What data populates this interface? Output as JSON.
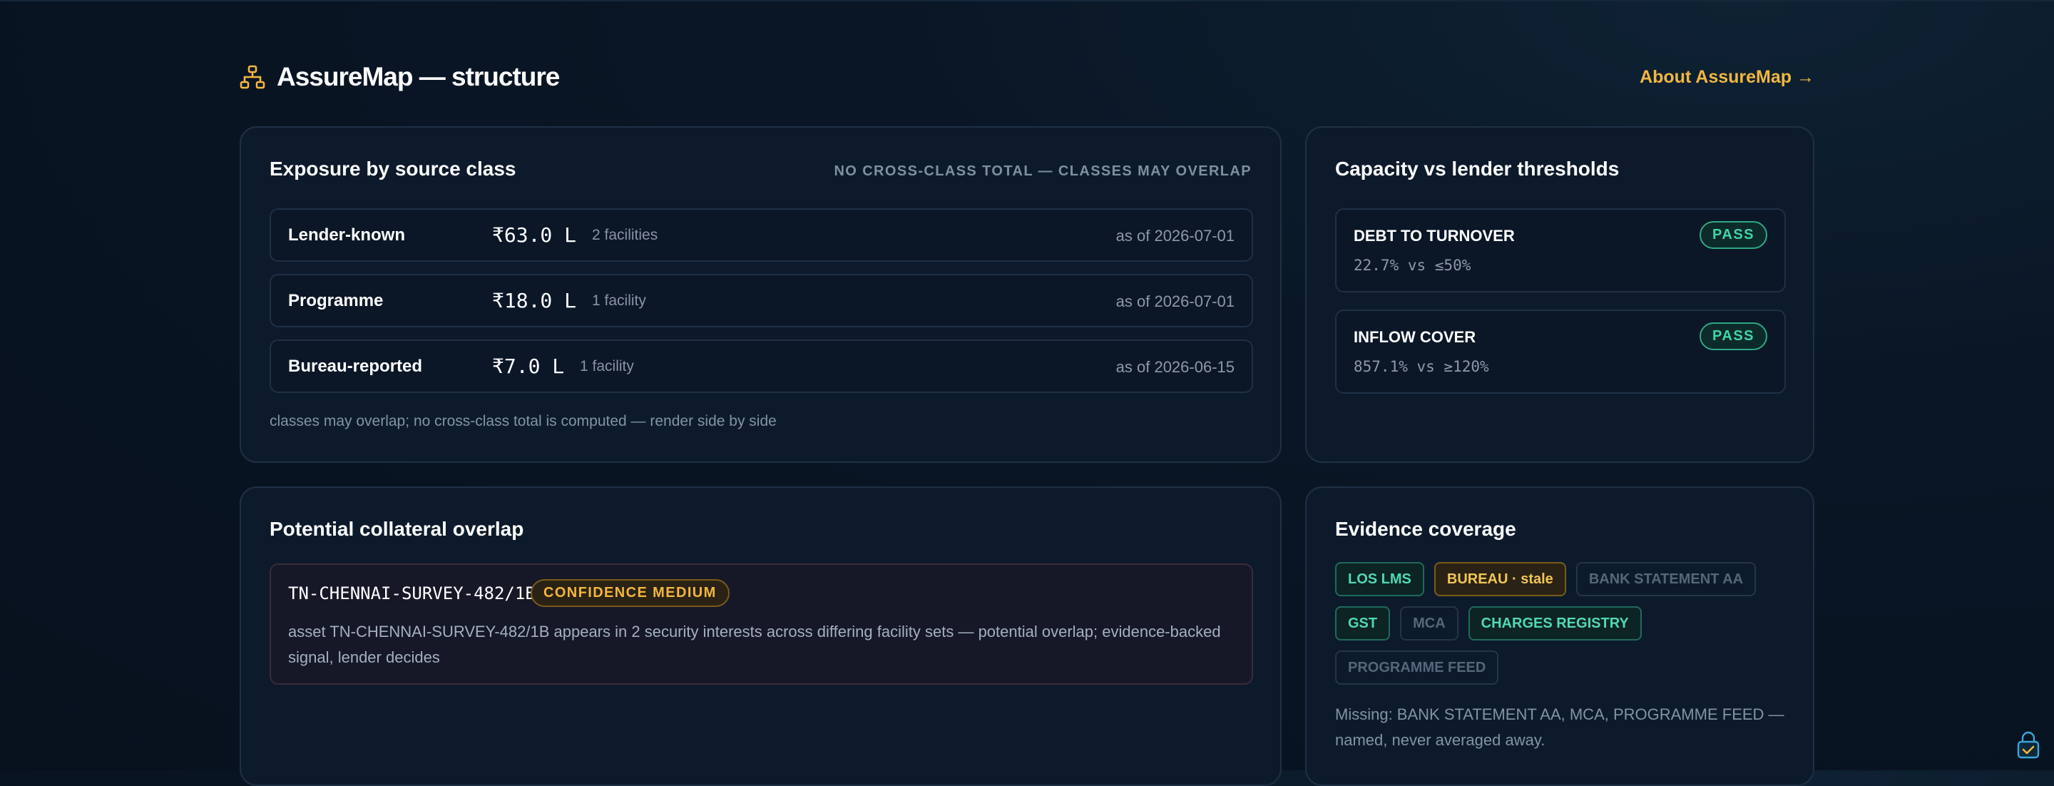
{
  "header": {
    "title": "AssureMap — structure",
    "about_link": "About AssureMap →"
  },
  "exposure": {
    "title": "Exposure by source class",
    "note": "NO CROSS-CLASS TOTAL — CLASSES MAY OVERLAP",
    "rows": [
      {
        "label": "Lender-known",
        "amount": "₹63.0 L",
        "count": "2 facilities",
        "as_of": "as of 2026-07-01"
      },
      {
        "label": "Programme",
        "amount": "₹18.0 L",
        "count": "1 facility",
        "as_of": "as of 2026-07-01"
      },
      {
        "label": "Bureau-reported",
        "amount": "₹7.0 L",
        "count": "1 facility",
        "as_of": "as of 2026-06-15"
      }
    ],
    "footnote": "classes may overlap; no cross-class total is computed — render side by side"
  },
  "capacity": {
    "title": "Capacity vs lender thresholds",
    "rows": [
      {
        "name": "DEBT TO TURNOVER",
        "value": "22.7% vs ≤50%",
        "status": "PASS"
      },
      {
        "name": "INFLOW COVER",
        "value": "857.1% vs ≥120%",
        "status": "PASS"
      }
    ]
  },
  "overlap": {
    "title": "Potential collateral overlap",
    "asset_id": "TN-CHENNAI-SURVEY-482/1B",
    "confidence": "CONFIDENCE MEDIUM",
    "description": "asset TN-CHENNAI-SURVEY-482/1B appears in 2 security interests across differing facility sets — potential overlap; evidence-backed signal, lender decides"
  },
  "evidence": {
    "title": "Evidence coverage",
    "chips": [
      {
        "label": "LOS LMS",
        "state": "ok"
      },
      {
        "label": "BUREAU · stale",
        "state": "stale"
      },
      {
        "label": "BANK STATEMENT AA",
        "state": "missing"
      },
      {
        "label": "GST",
        "state": "ok"
      },
      {
        "label": "MCA",
        "state": "missing"
      },
      {
        "label": "CHARGES REGISTRY",
        "state": "ok"
      },
      {
        "label": "PROGRAMME FEED",
        "state": "missing"
      }
    ],
    "missing_note": "Missing: BANK STATEMENT AA, MCA, PROGRAMME FEED — named, never averaged away."
  },
  "colors": {
    "accent": "#f2b740",
    "pass": "#3fd6a6",
    "background": "#07111e"
  },
  "icons": {
    "brand": "hierarchy-icon",
    "widget": "lock-check-icon"
  }
}
